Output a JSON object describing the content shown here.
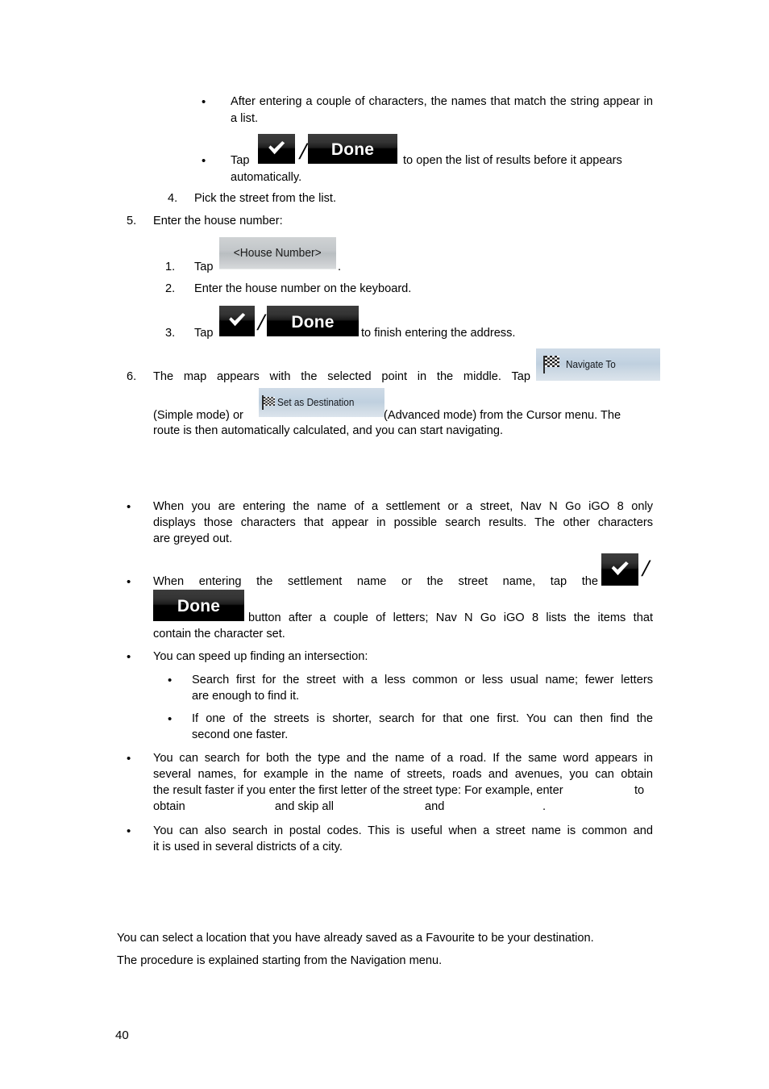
{
  "document": {
    "page_number": "40",
    "product_name": "Nav N Go iGO 8"
  },
  "steps_section": {
    "sub_bullets": [
      {
        "id": "after-entering",
        "text": "After entering a couple of characters, the names that match the string appear in a list."
      },
      {
        "id": "tap-done",
        "lead": "Tap",
        "trail_line1": "to open the list of results before it appears",
        "trail_line2": "automatically."
      }
    ],
    "step4": {
      "marker": "4.",
      "text": "Pick the street from the list."
    },
    "step5": {
      "marker": "5.",
      "text": "Enter the house number:",
      "substeps": [
        {
          "marker": "1.",
          "lead": "Tap",
          "trail": "."
        },
        {
          "marker": "2.",
          "text": "Enter the house number on the keyboard."
        },
        {
          "marker": "3.",
          "lead": "Tap",
          "trail": "to finish entering the address."
        }
      ]
    },
    "step6": {
      "marker": "6.",
      "line1": "The map appears with the selected point in the middle. Tap",
      "line2_lead": "(Simple mode) or",
      "line2_trail": "(Advanced mode) from the Cursor menu. The",
      "line3": "route is then automatically calculated, and you can start navigating."
    }
  },
  "tips_section": {
    "bullets": [
      {
        "id": "greyed-characters",
        "line1": "When you are entering the name of a settlement or a street, Nav N Go iGO 8 only",
        "line2": "displays those characters that appear in possible search results. The other characters",
        "line3": "are greyed out."
      },
      {
        "id": "tap-done-button",
        "line1": "When entering the settlement name or the street name, tap the",
        "line2_trail": "button after a couple of letters; Nav N Go iGO 8 lists the items that",
        "line3": "contain the character set."
      },
      {
        "id": "speed-up-intersection",
        "text": "You can speed up finding an intersection:",
        "sub_bullets": [
          {
            "id": "less-common-name",
            "line1": "Search first for the street with a less common or less usual name; fewer letters",
            "line2": "are enough to find it."
          },
          {
            "id": "shorter-street",
            "line1": "If one of the streets is shorter, search for that one first. You can then find the",
            "line2": "second one faster."
          }
        ]
      },
      {
        "id": "road-type-and-name",
        "line1": "You can search for both the type and the name of a road. If the same word appears in",
        "line2": "several names, for example in the name of streets, roads and avenues, you can obtain",
        "line3a": "the result faster if you enter the first letter of the street type: For example, enter",
        "line3b": "to",
        "line4a": "obtain",
        "line4b": "and skip all",
        "line4c": "and",
        "line4d": "."
      },
      {
        "id": "postal-codes",
        "line1": "You can also search in postal codes. This is useful when a street name is common and",
        "line2": "it is used in several districts of a city."
      }
    ]
  },
  "favourites_section": {
    "paragraph1": "You can select a location that you have already saved as a Favourite to be your destination.",
    "paragraph2": "The procedure is explained starting from the Navigation menu."
  },
  "ui_buttons": {
    "done_label": "Done",
    "check_icon": "check-icon",
    "house_number_label": "<House Number>",
    "navigate_to_label": "Navigate To",
    "set_as_destination_label": "Set as Destination",
    "slash": "/"
  },
  "colors": {
    "dark_button_top": "#3c3c3c",
    "dark_button_bottom": "#000000",
    "grey_button": "#c3c7ca",
    "blue_button": "#c6d5e3",
    "text": "#000000"
  }
}
